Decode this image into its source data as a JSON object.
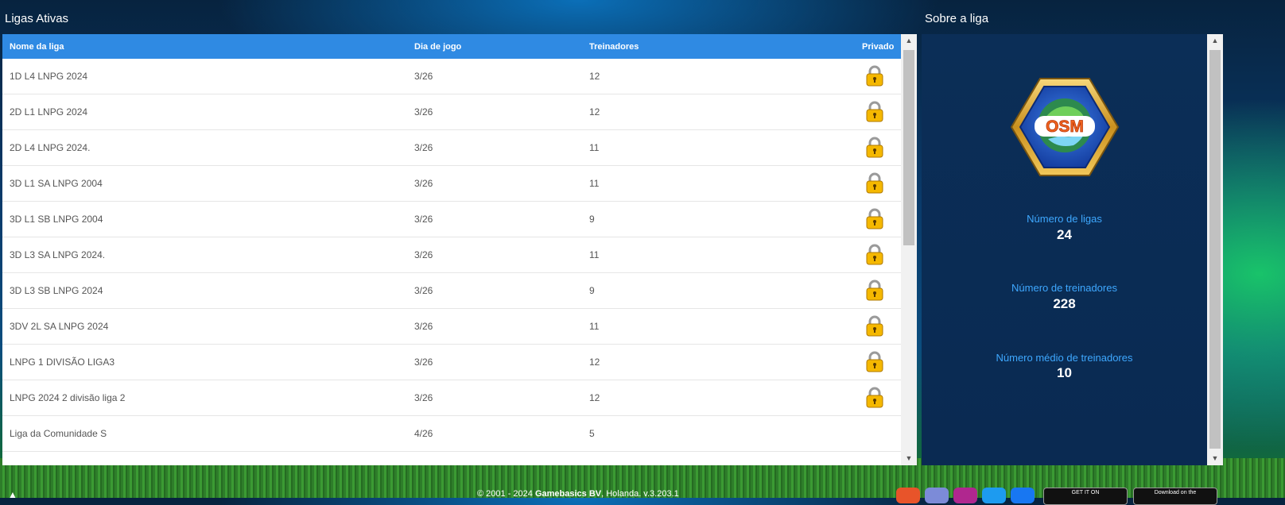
{
  "leagues": {
    "title": "Ligas Ativas",
    "columns": {
      "name": "Nome da liga",
      "day": "Dia de jogo",
      "coaches": "Treinadores",
      "private": "Privado"
    },
    "rows": [
      {
        "name": "1D L4 LNPG 2024",
        "day": "3/26",
        "coaches": "12",
        "private": true
      },
      {
        "name": "2D L1 LNPG 2024",
        "day": "3/26",
        "coaches": "12",
        "private": true
      },
      {
        "name": "2D L4 LNPG 2024.",
        "day": "3/26",
        "coaches": "11",
        "private": true
      },
      {
        "name": "3D L1 SA LNPG 2004",
        "day": "3/26",
        "coaches": "11",
        "private": true
      },
      {
        "name": "3D L1 SB LNPG 2004",
        "day": "3/26",
        "coaches": "9",
        "private": true
      },
      {
        "name": "3D L3 SA LNPG 2024.",
        "day": "3/26",
        "coaches": "11",
        "private": true
      },
      {
        "name": "3D L3 SB LNPG 2024",
        "day": "3/26",
        "coaches": "9",
        "private": true
      },
      {
        "name": "3DV 2L SA LNPG 2024",
        "day": "3/26",
        "coaches": "11",
        "private": true
      },
      {
        "name": "LNPG 1 DIVISÃO LIGA3",
        "day": "3/26",
        "coaches": "12",
        "private": true
      },
      {
        "name": "LNPG 2024 2 divisão liga 2",
        "day": "3/26",
        "coaches": "12",
        "private": true
      },
      {
        "name": "Liga da Comunidade S",
        "day": "4/26",
        "coaches": "5",
        "private": false
      }
    ],
    "scroll_fraction": 0.0
  },
  "about": {
    "title": "Sobre a liga",
    "logo_text": "OSM",
    "stats": [
      {
        "label": "Número de ligas",
        "value": "24"
      },
      {
        "label": "Número de treinadores",
        "value": "228"
      },
      {
        "label": "Número médio de treinadores",
        "value": "10"
      }
    ]
  },
  "footer": {
    "copyright": "© 2001 - 2024",
    "company": "Gamebasics BV",
    "rest": ", Holanda. v.3.203.1",
    "store_google": "GET IT ON",
    "store_apple": "Download on the"
  },
  "colors": {
    "header_blue": "#2f8ae3",
    "lock_gold": "#f5b800",
    "stat_label": "#3ea8ff"
  }
}
